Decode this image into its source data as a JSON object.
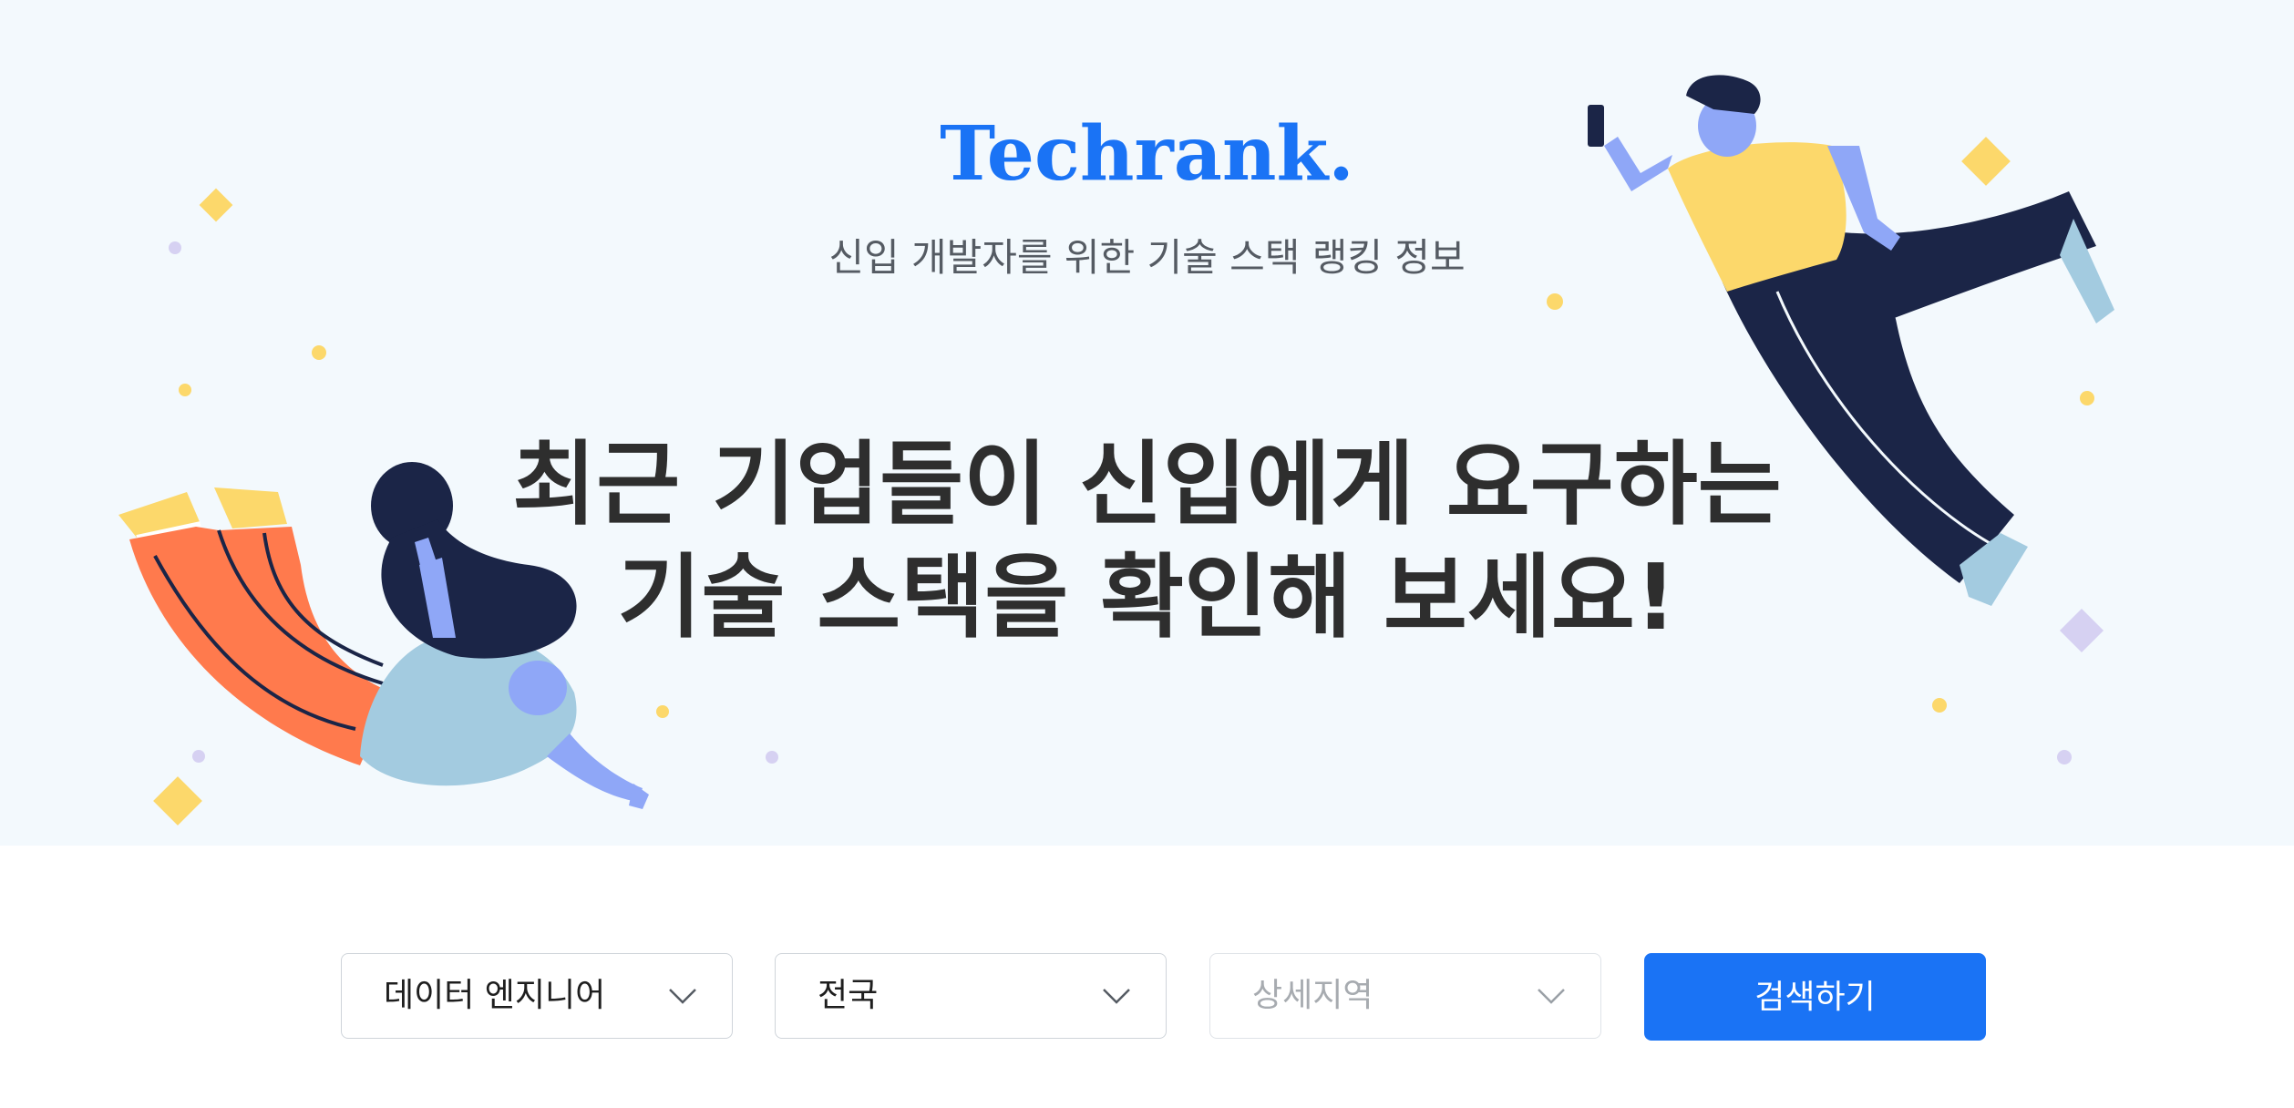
{
  "hero": {
    "brand": "Techrank.",
    "subtitle": "신입 개발자를 위한 기술 스택 랭킹 정보",
    "headline_line1": "최근 기업들이 신입에게 요구하는",
    "headline_line2": "기술 스택을 확인해 보세요!"
  },
  "search": {
    "job_select": {
      "value": "데이터 엔지니어",
      "icon": "chevron-down-icon"
    },
    "region_select": {
      "value": "전국",
      "icon": "chevron-down-icon"
    },
    "subregion_select": {
      "placeholder": "상세지역",
      "disabled": true,
      "icon": "chevron-down-icon"
    },
    "submit_label": "검색하기"
  },
  "colors": {
    "brand": "#1a73f5",
    "hero_background": "#f3f9fd",
    "headline": "#2e2e2e",
    "subtitle": "#555b63",
    "accent_yellow": "#fcd86b",
    "accent_lavender": "#cfc9ef"
  },
  "illustrations": {
    "left": "woman-flying-illustration",
    "right": "man-with-phone-illustration"
  }
}
